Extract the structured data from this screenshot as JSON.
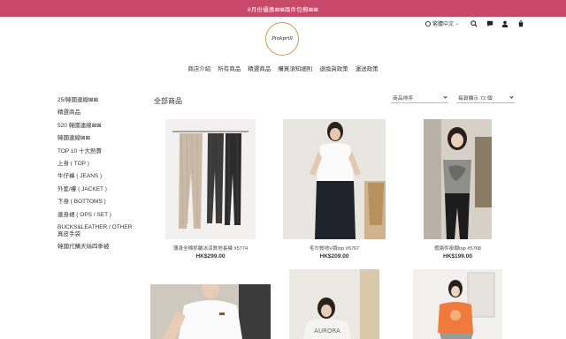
{
  "announcement": "8月份優惠⊠⊠兩件包郵⊠⊠",
  "topbar": {
    "language": "繁體中文",
    "icons": [
      "globe-icon",
      "search-icon",
      "chat-icon",
      "account-icon",
      "cart-icon"
    ]
  },
  "logo": {
    "text": "Pinkprill"
  },
  "nav": [
    "商店介紹",
    "所有商品",
    "精選商品",
    "購買須知細則",
    "退換貨政策",
    "運送政策"
  ],
  "sidebar": [
    "25/韓國連線⊠⊠",
    "精選商品",
    "520 韓國連線⊠⊠",
    "韓國連線⊠⊠",
    "TOP 10 十大熱賣",
    "上身 ( TOP )",
    "牛仔褲 ( JEANS )",
    "外套/褸 ( JACKET )",
    "下身 ( BOTTOMS )",
    "連身裙 ( OPS / SET )",
    "BUCKS&LEATHER / OTHER",
    "真皮手袋",
    "韓國代購天絲四季被"
  ],
  "main": {
    "title": "全部商品",
    "sort_label": "商品排序",
    "per_page_label": "每頁顯示 72 個"
  },
  "products": [
    {
      "name": "薄身全棉抓皺冰涼質地長褲 #5774",
      "price": "HK$299.00"
    },
    {
      "name": "毛巾質地V領top #5767",
      "price": "HK$209.00"
    },
    {
      "name": "假兩件掛頸top #5768",
      "price": "HK$199.00"
    },
    {
      "name": "",
      "price": ""
    },
    {
      "name": "",
      "price": ""
    },
    {
      "name": "",
      "price": ""
    }
  ],
  "colors": {
    "announce_bg": "#c8486a",
    "logo_ring": "#c99a5a"
  }
}
